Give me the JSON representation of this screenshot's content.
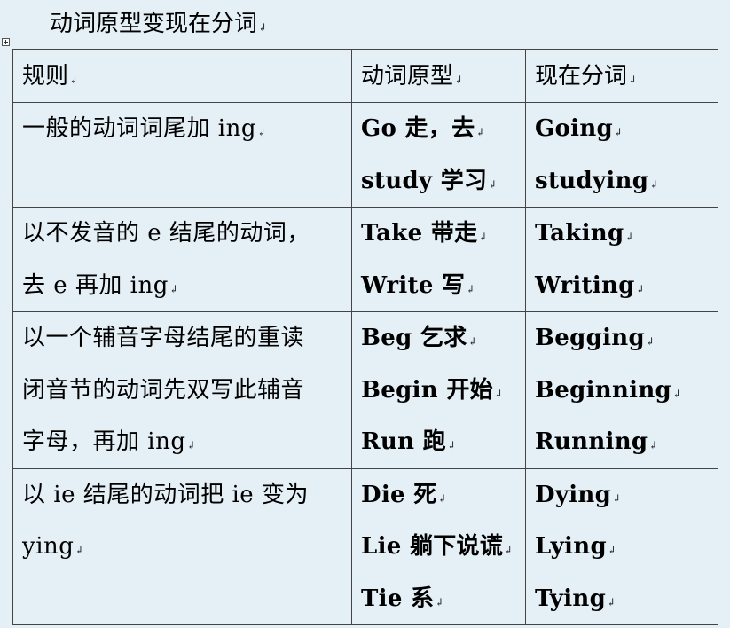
{
  "title": "动词原型变现在分词",
  "paragraph_mark": "↲",
  "table": {
    "headers": [
      "规则",
      "动词原型",
      "现在分词"
    ],
    "rows": [
      {
        "rule_lines": [
          "一般的动词词尾加 ing"
        ],
        "base_lines": [
          "Go  走，去",
          "study 学习"
        ],
        "participle_lines": [
          "Going",
          "studying"
        ]
      },
      {
        "rule_lines": [
          "以不发音的 e 结尾的动词，",
          "去 e 再加 ing"
        ],
        "base_lines": [
          "Take  带走",
          "Write 写"
        ],
        "participle_lines": [
          "Taking",
          "Writing"
        ]
      },
      {
        "rule_lines": [
          "以一个辅音字母结尾的重读",
          "闭音节的动词先双写此辅音",
          "字母，再加 ing"
        ],
        "base_lines": [
          "Beg 乞求",
          "Begin 开始",
          "Run  跑"
        ],
        "participle_lines": [
          "Begging",
          "Beginning",
          "Running"
        ]
      },
      {
        "rule_lines": [
          "以  ie  结尾的动词把  ie  变为",
          "ying"
        ],
        "base_lines": [
          "Die 死",
          "Lie 躺下说谎",
          "Tie 系"
        ],
        "participle_lines": [
          "Dying",
          "Lying",
          "Tying"
        ]
      }
    ]
  }
}
